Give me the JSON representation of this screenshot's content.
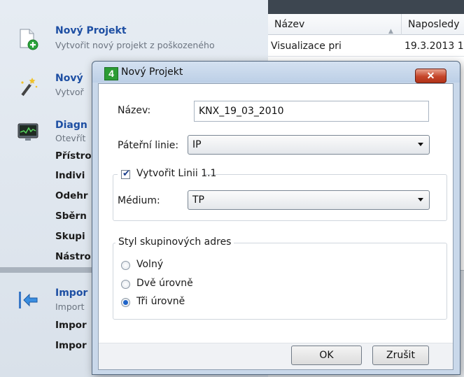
{
  "background": {
    "tasks": [
      {
        "title": "Nový Projekt",
        "subtitle": "Vytvořit nový projekt z poškozeného",
        "icon": "new-project-icon"
      },
      {
        "title": "Nový",
        "subtitle": "Vytvoř",
        "icon": "wizard-icon"
      },
      {
        "title": "Diagn",
        "subtitle": "Otevřít",
        "icon": "diagnostics-icon",
        "items": [
          "Přístro",
          "Indivi",
          "Odehr",
          "Sběrn",
          "Skupi",
          "Nástro"
        ]
      },
      {
        "title": "Impor",
        "subtitle": "Import",
        "icon": "import-arrow-icon",
        "items": [
          "Impor",
          "Impor"
        ]
      }
    ],
    "table": {
      "columns": [
        "Název",
        "Naposledy"
      ],
      "rows": [
        [
          "Visualizace pri",
          "19.3.2013 1"
        ]
      ]
    }
  },
  "dialog": {
    "title": "Nový Projekt",
    "app_icon_text": "4",
    "close_glyph": "✕",
    "name_label": "Název:",
    "name_value": "KNX_19_03_2010",
    "backbone_label": "Páteřní linie:",
    "backbone_value": "IP",
    "create_line_label": "Vytvořit Linii 1.1",
    "create_line_checked": true,
    "medium_label": "Médium:",
    "medium_value": "TP",
    "group_address_style": {
      "legend": "Styl skupinových adres",
      "options": [
        "Volný",
        "Dvě úrovně",
        "Tři úrovně"
      ],
      "selected": "Tři úrovně"
    },
    "ok_label": "OK",
    "cancel_label": "Zrušit"
  }
}
